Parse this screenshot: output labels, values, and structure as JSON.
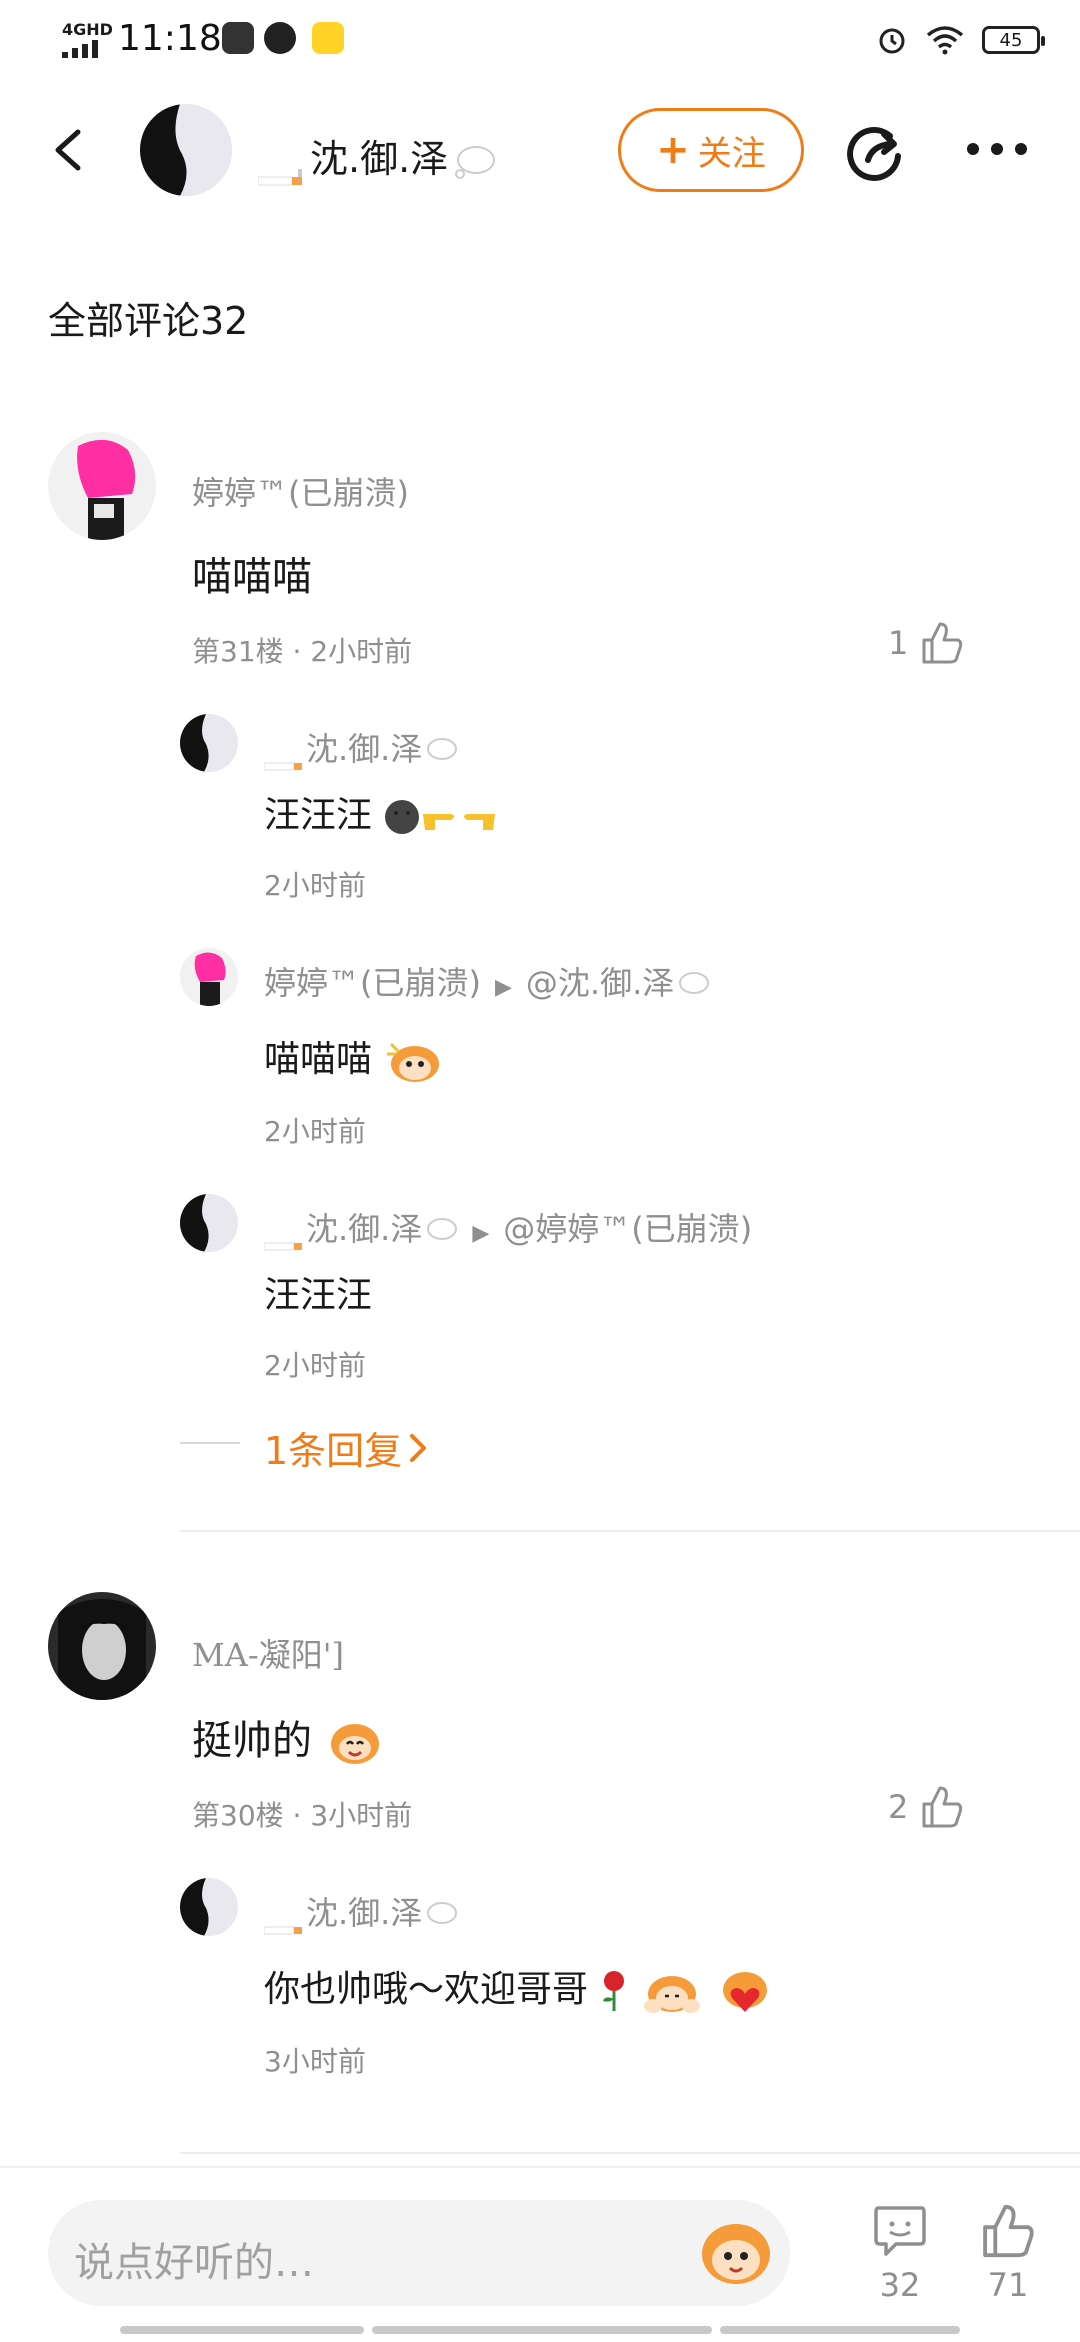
{
  "status_bar": {
    "network": "4GHD",
    "time": "11:18",
    "battery": "45"
  },
  "header": {
    "username": "沈.御.泽",
    "follow_label": "关注"
  },
  "section_title": "全部评论32",
  "comments": [
    {
      "user": "婷婷™(已崩溃)",
      "text": "喵喵喵",
      "floor": "第31楼",
      "time": "2小时前",
      "likes": "1",
      "replies": [
        {
          "user": "沈.御.泽",
          "text": "汪汪汪",
          "time": "2小时前"
        },
        {
          "user": "婷婷™(已崩溃)",
          "reply_to": "@沈.御.泽",
          "text": "喵喵喵",
          "time": "2小时前"
        },
        {
          "user": "沈.御.泽",
          "reply_to": "@婷婷™(已崩溃)",
          "text": "汪汪汪",
          "time": "2小时前"
        }
      ],
      "more_replies": "1条回复"
    },
    {
      "user": "MA-凝阳']",
      "text": "挺帅的",
      "floor": "第30楼",
      "time": "3小时前",
      "likes": "2",
      "replies": [
        {
          "user": "沈.御.泽",
          "text": "你也帅哦～欢迎哥哥",
          "time": "3小时前"
        }
      ]
    }
  ],
  "bottom_bar": {
    "input_placeholder": "说点好听的…",
    "comment_count": "32",
    "like_count": "71"
  },
  "colors": {
    "accent": "#f07c17",
    "muted": "#8f8f8f"
  }
}
